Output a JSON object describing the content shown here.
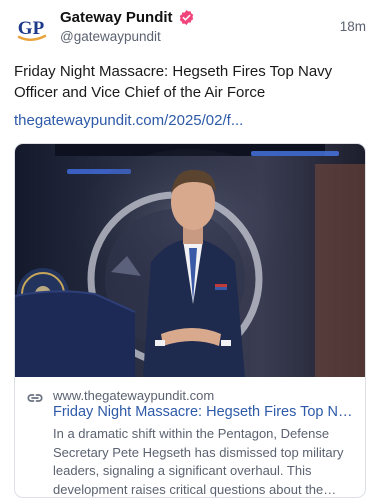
{
  "post": {
    "author": {
      "display_name": "Gateway Pundit",
      "handle": "@gatewaypundit",
      "avatar_text": "GP",
      "verified_icon": "verified-badge-icon",
      "brand_color": "#1d3a8a",
      "accent_color": "#e8a33a",
      "verified_color": "#f0457a"
    },
    "timestamp": "18m",
    "text": "Friday Night Massacre: Hegseth Fires Top Navy Officer and Vice Chief of the Air Force",
    "link_text": "thegatewaypundit.com/2025/02/f...",
    "link_color": "#2e5aa8"
  },
  "card": {
    "image_alt": "Pete Hegseth standing at a podium in the Pentagon briefing room",
    "link_icon": "link-icon",
    "domain": "www.thegatewaypundit.com",
    "title": "Friday Night Massacre: Hegseth Fires Top Navy Officer and Vice Chief of the Air Force",
    "description": "In a dramatic shift within the Pentagon, Defense Secretary Pete Hegseth has dismissed top military leaders, signaling a significant overhaul. This development raises critical questions about the future..."
  }
}
